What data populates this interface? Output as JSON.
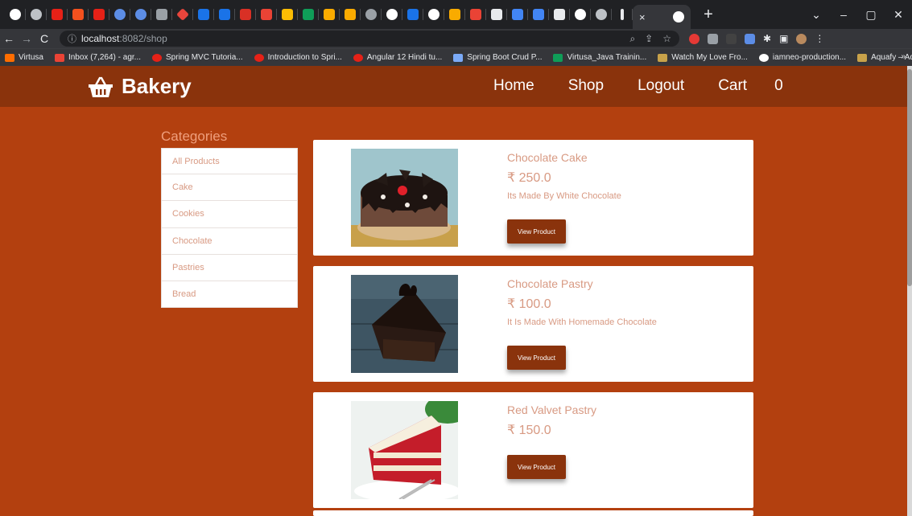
{
  "browser": {
    "url_host": "localhost",
    "url_port": ":8082/shop",
    "bookmarks": [
      "Virtusa",
      "Inbox (7,264) - agr...",
      "Spring MVC Tutoria...",
      "Introduction to Spri...",
      "Angular 12 Hindi tu...",
      "Spring Boot Crud P...",
      "Virtusa_Java Trainin...",
      "Watch My Love Fro...",
      "iamneo-production...",
      "Aquafy – Aqua Far..."
    ],
    "bookmark_more": "»"
  },
  "header": {
    "brand": "Bakery",
    "nav": {
      "home": "Home",
      "shop": "Shop",
      "logout": "Logout",
      "cart": "Cart",
      "cart_count": "0"
    }
  },
  "categories": {
    "title": "Categories",
    "items": [
      "All Products",
      "Cake",
      "Cookies",
      "Chocolate",
      "Pastries",
      "Bread"
    ]
  },
  "products": [
    {
      "name": "Chocolate Cake",
      "price": "₹ 250.0",
      "description": "Its Made By White Chocolate",
      "button": "View Product"
    },
    {
      "name": "Chocolate Pastry",
      "price": "₹ 100.0",
      "description": "It Is Made With Homemade Chocolate",
      "button": "View Product"
    },
    {
      "name": "Red Valvet Pastry",
      "price": "₹ 150.0",
      "description": "",
      "button": "View Product"
    }
  ]
}
